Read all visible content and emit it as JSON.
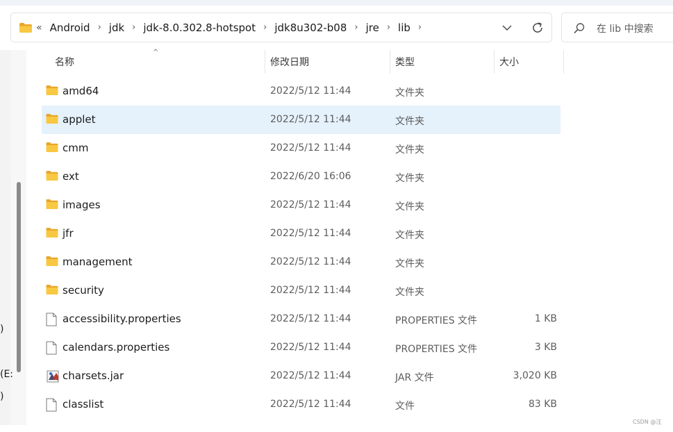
{
  "address": {
    "overflow": "«",
    "crumbs": [
      "Android",
      "jdk",
      "jdk-8.0.302.8-hotspot",
      "jdk8u302-b08",
      "jre",
      "lib"
    ]
  },
  "search": {
    "placeholder": "在 lib 中搜索"
  },
  "nav_fragments": [
    ")",
    "(E:",
    ")"
  ],
  "columns": {
    "name": "名称",
    "modified": "修改日期",
    "type": "类型",
    "size": "大小"
  },
  "files": [
    {
      "name": "amd64",
      "modified": "2022/5/12 11:44",
      "type": "文件夹",
      "size": "",
      "icon": "folder-icon"
    },
    {
      "name": "applet",
      "modified": "2022/5/12 11:44",
      "type": "文件夹",
      "size": "",
      "icon": "folder-icon",
      "selected": true
    },
    {
      "name": "cmm",
      "modified": "2022/5/12 11:44",
      "type": "文件夹",
      "size": "",
      "icon": "folder-icon"
    },
    {
      "name": "ext",
      "modified": "2022/6/20 16:06",
      "type": "文件夹",
      "size": "",
      "icon": "folder-icon"
    },
    {
      "name": "images",
      "modified": "2022/5/12 11:44",
      "type": "文件夹",
      "size": "",
      "icon": "folder-icon"
    },
    {
      "name": "jfr",
      "modified": "2022/5/12 11:44",
      "type": "文件夹",
      "size": "",
      "icon": "folder-icon"
    },
    {
      "name": "management",
      "modified": "2022/5/12 11:44",
      "type": "文件夹",
      "size": "",
      "icon": "folder-icon"
    },
    {
      "name": "security",
      "modified": "2022/5/12 11:44",
      "type": "文件夹",
      "size": "",
      "icon": "folder-icon"
    },
    {
      "name": "accessibility.properties",
      "modified": "2022/5/12 11:44",
      "type": "PROPERTIES 文件",
      "size": "1 KB",
      "icon": "file-icon"
    },
    {
      "name": "calendars.properties",
      "modified": "2022/5/12 11:44",
      "type": "PROPERTIES 文件",
      "size": "3 KB",
      "icon": "file-icon"
    },
    {
      "name": "charsets.jar",
      "modified": "2022/5/12 11:44",
      "type": "JAR 文件",
      "size": "3,020 KB",
      "icon": "jar-file-icon"
    },
    {
      "name": "classlist",
      "modified": "2022/5/12 11:44",
      "type": "文件",
      "size": "83 KB",
      "icon": "file-icon"
    }
  ],
  "watermark": "CSDN @汪",
  "colors": {
    "folder": "#f8c843",
    "selection": "#e5f1fb",
    "accent": "#0067c0"
  }
}
